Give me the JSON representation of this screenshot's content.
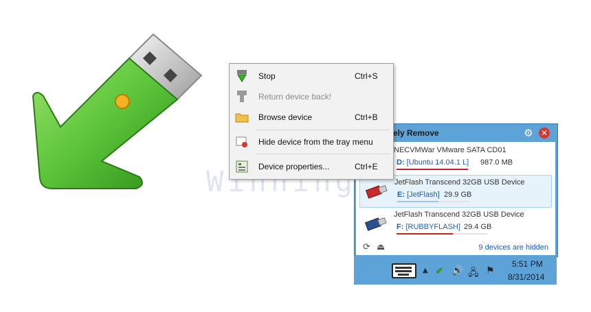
{
  "watermark": "WinningPC",
  "context_menu": {
    "items": [
      {
        "label": "Stop",
        "shortcut": "Ctrl+S",
        "icon": "stop-green-arrow-icon",
        "enabled": true
      },
      {
        "label": "Return device back!",
        "shortcut": "",
        "icon": "return-device-icon",
        "enabled": false
      },
      {
        "label": "Browse device",
        "shortcut": "Ctrl+B",
        "icon": "folder-icon",
        "enabled": true
      },
      {
        "label": "Hide device from the tray menu",
        "shortcut": "",
        "icon": "hide-device-icon",
        "enabled": true
      },
      {
        "label": "Device properties...",
        "shortcut": "Ctrl+E",
        "icon": "properties-icon",
        "enabled": true
      }
    ]
  },
  "panel": {
    "title": "fely Remove",
    "devices": [
      {
        "name": "NECVMWar VMware SATA CD01",
        "letter": "D:",
        "volume": "[Ubuntu 14.04.1 L]",
        "size": "987.0 MB",
        "icon": "cd-drive-icon",
        "selected": false
      },
      {
        "name": "JetFlash Transcend 32GB USB Device",
        "letter": "E:",
        "volume": "[JetFlash]",
        "size": "29.9 GB",
        "icon": "usb-red-icon",
        "selected": true
      },
      {
        "name": "JetFlash Transcend 32GB USB Device",
        "letter": "F:",
        "volume": "[RUBBYFLASH]",
        "size": "29.4 GB",
        "icon": "usb-blue-icon",
        "selected": false
      }
    ],
    "hidden_text": "9 devices are hidden"
  },
  "taskbar": {
    "time": "5:51 PM",
    "date": "8/31/2014"
  },
  "colors": {
    "accent": "#5ea3d8",
    "link": "#1f5fb3",
    "underline": "#cc1f1f",
    "logo_green": "#5cc43a"
  }
}
